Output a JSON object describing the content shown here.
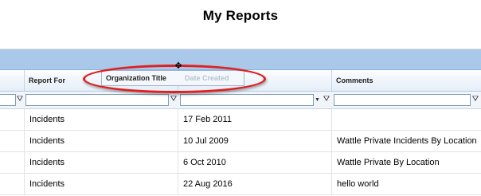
{
  "page": {
    "title": "My Reports"
  },
  "columns": [
    {
      "label": "Report For"
    },
    {
      "label": "Date Created"
    },
    {
      "label": "Comments"
    }
  ],
  "drag": {
    "dragged_label": "Organization Title",
    "target_label": "Date Created"
  },
  "rows": [
    {
      "report_for": "Incidents",
      "date_created": "17 Feb 2011",
      "comments": ""
    },
    {
      "report_for": "Incidents",
      "date_created": "10 Jul 2009",
      "comments": "Wattle Private Incidents By Location"
    },
    {
      "report_for": "Incidents",
      "date_created": "6 Oct 2010",
      "comments": "Wattle Private By Location"
    },
    {
      "report_for": "Incidents",
      "date_created": "22 Aug 2016",
      "comments": "hello world"
    }
  ],
  "colors": {
    "group_panel": "#a9c8ea",
    "highlight": "#e02020"
  },
  "icons": {
    "filter": "funnel-icon",
    "dropdown": "chevron-down-icon",
    "cursor": "move-cursor-icon"
  }
}
